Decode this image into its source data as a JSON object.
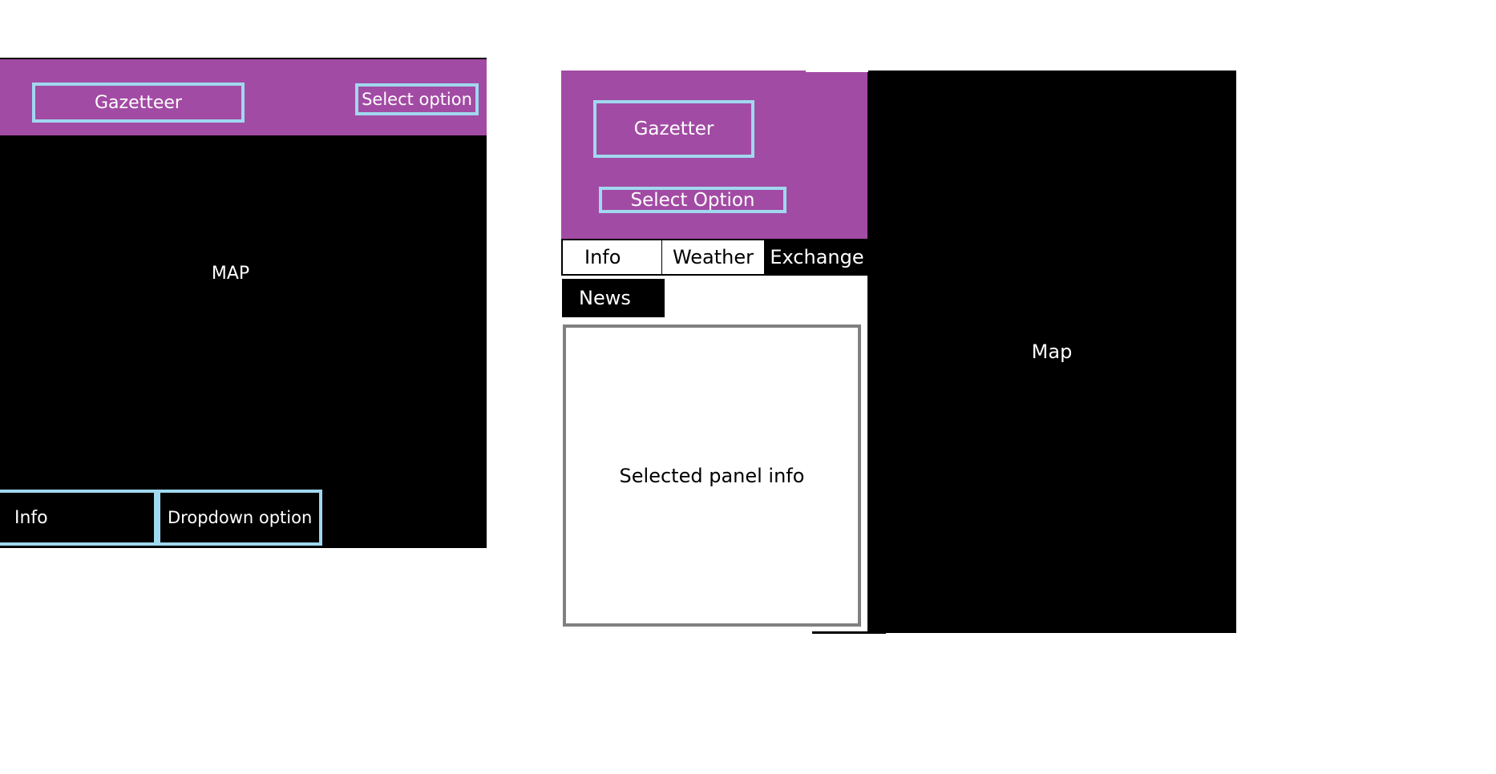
{
  "colors": {
    "header_purple": "#a24ba4",
    "highlight_cyan": "#a0d8ef",
    "map_black": "#000000",
    "panel_border": "#808080"
  },
  "mobile_mockup": {
    "brand": "Gazetteer",
    "select": "Select option",
    "map_label": "MAP",
    "info_button": "Info",
    "dropdown_button": "Dropdown option"
  },
  "desktop_mockup": {
    "brand": "Gazetter",
    "select": "Select Option",
    "tabs": [
      "Info",
      "Weather",
      "Exchange",
      "News"
    ],
    "active_tab": "Info",
    "panel_text": "Selected panel info",
    "map_label": "Map"
  }
}
